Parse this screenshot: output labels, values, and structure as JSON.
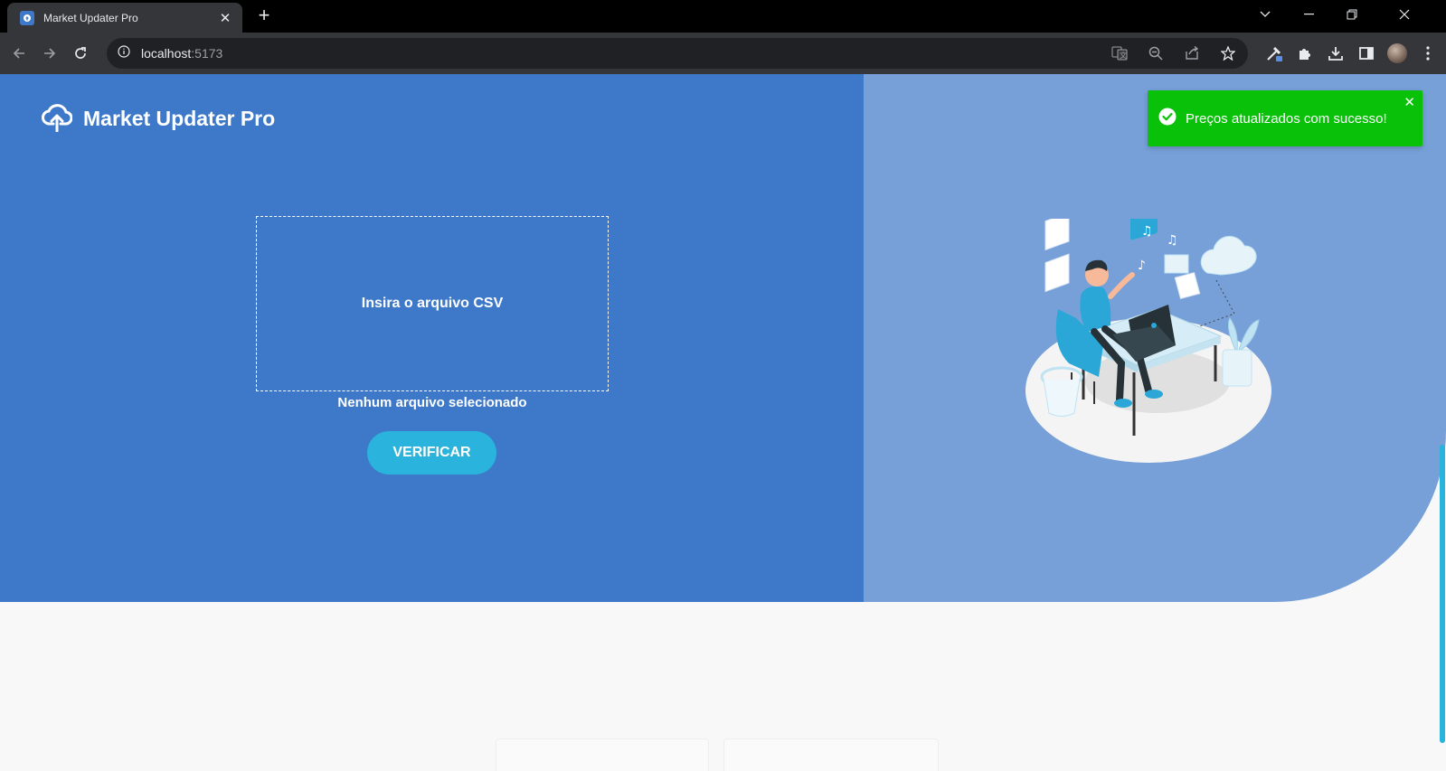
{
  "browser": {
    "tab_title": "Market Updater Pro",
    "url_host": "localhost",
    "url_port": ":5173"
  },
  "app": {
    "brand_name": "Market Updater Pro",
    "dropzone_label": "Insira o arquivo CSV",
    "file_status": "Nenhum arquivo selecionado",
    "verify_label": "VERIFICAR"
  },
  "toast": {
    "message": "Preços atualizados com sucesso!",
    "type": "success"
  },
  "colors": {
    "primary": "#3e79c9",
    "secondary": "#77a0d9",
    "button": "#2ab3dc",
    "success": "#0ac10a"
  }
}
